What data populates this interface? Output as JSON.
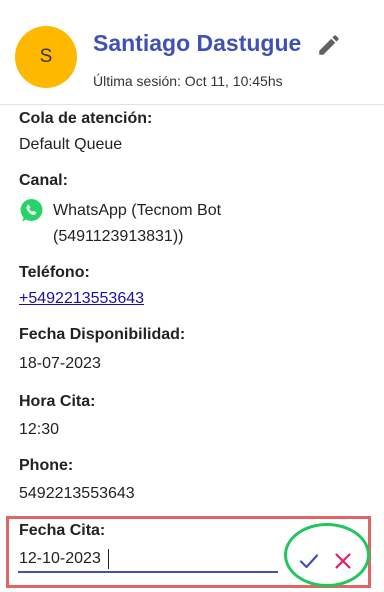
{
  "header": {
    "avatar_initial": "S",
    "contact_name": "Santiago Dastugue",
    "last_session": "Última sesión: Oct 11, 10:45hs"
  },
  "fields": {
    "queue_label": "Cola de atención:",
    "queue_value": "Default Queue",
    "channel_label": "Canal:",
    "channel_line1": "WhatsApp (Tecnom Bot",
    "channel_line2": "(5491123913831))",
    "phone_label": "Teléfono:",
    "phone_value": "+5492213553643",
    "availability_label": "Fecha Disponibilidad:",
    "availability_value": "18-07-2023",
    "appointment_time_label": "Hora Cita:",
    "appointment_time_value": "12:30",
    "phone2_label": "Phone:",
    "phone2_value": "5492213553643"
  },
  "edit_field": {
    "label": "Fecha Cita:",
    "value": "12-10-2023"
  },
  "icons": {
    "edit": "pencil-icon",
    "channel": "whatsapp-icon",
    "confirm": "check-icon",
    "cancel": "close-icon"
  },
  "colors": {
    "avatar_bg": "#ffb800",
    "name": "#3f51b5",
    "link": "#1a0dab",
    "whatsapp": "#25d366",
    "confirm": "#3f51b5",
    "cancel": "#e91e63",
    "highlight_box": "#e06666",
    "highlight_ring": "#22c55e"
  }
}
